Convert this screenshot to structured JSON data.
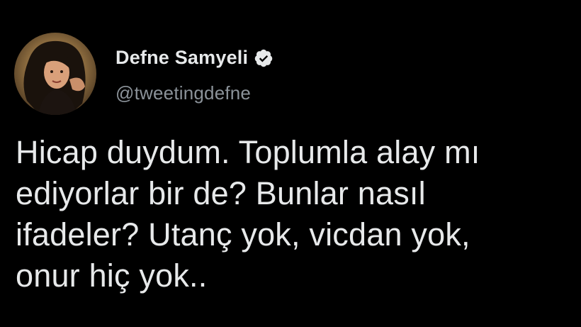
{
  "tweet": {
    "author": {
      "display_name": "Defne Samyeli",
      "handle": "@tweetingdefne",
      "verified_icon": "verified-badge-icon",
      "avatar": "profile-photo"
    },
    "text_lines": [
      "Hicap duydum. Toplumla alay mı",
      "ediyorlar bir de? Bunlar nasıl",
      "ifadeler? Utanç yok, vicdan yok,",
      "onur hiç yok.."
    ]
  },
  "colors": {
    "background": "#000000",
    "text_primary": "#e7e9ea",
    "text_secondary": "#8b9299",
    "verified_badge": "#e7e9ea"
  }
}
